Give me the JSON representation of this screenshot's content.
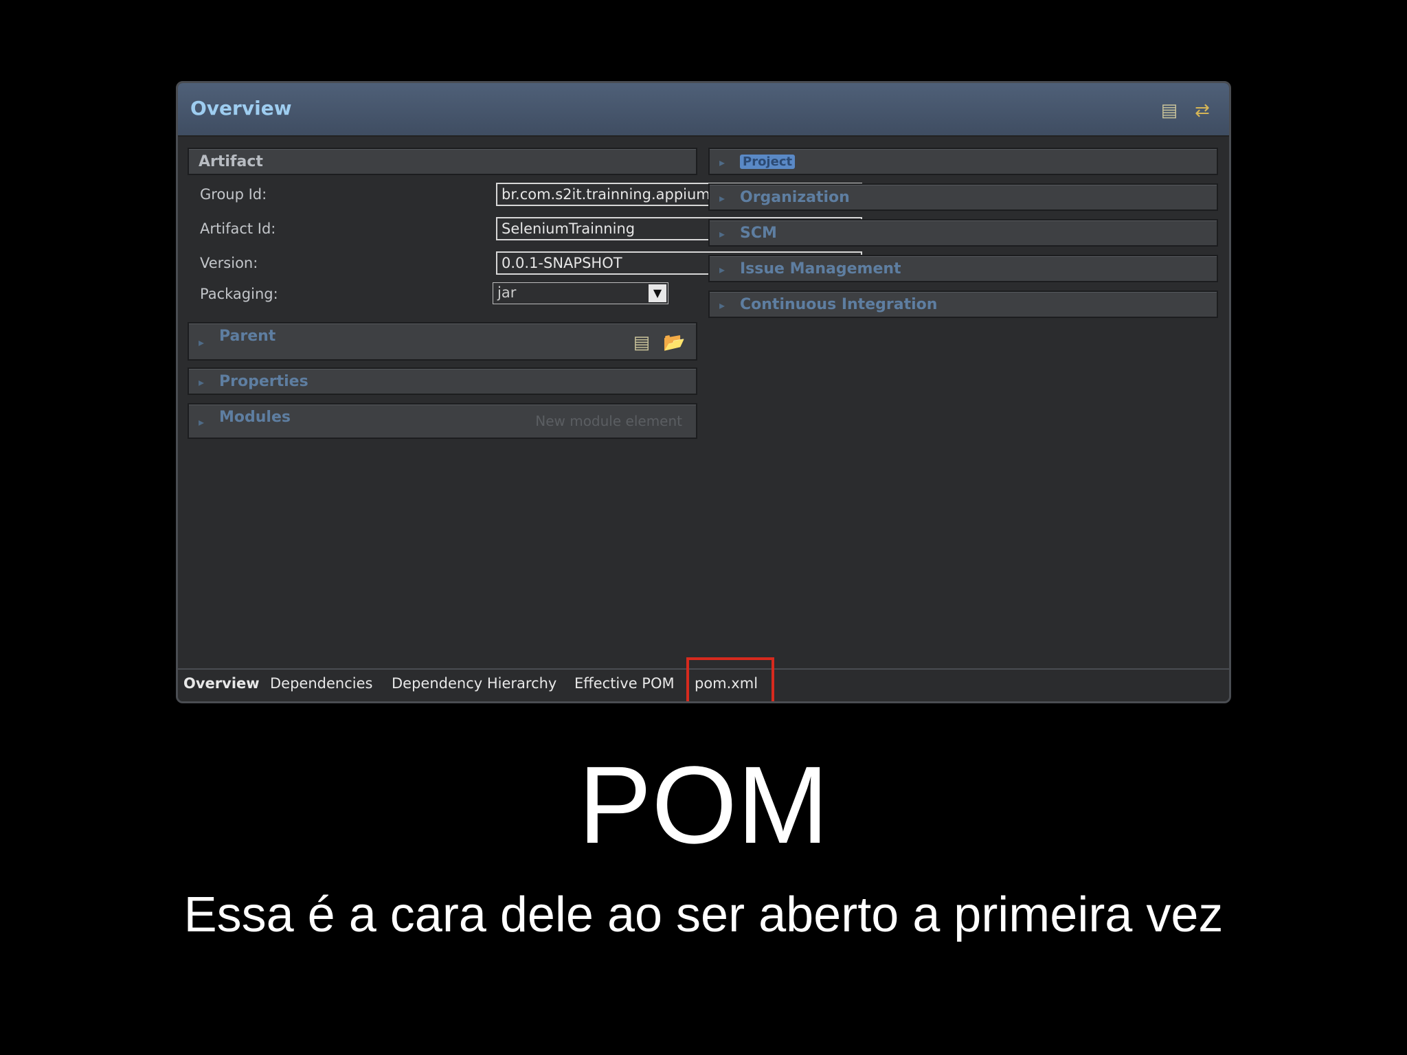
{
  "editor": {
    "title": "Overview",
    "artifact": {
      "section_title": "Artifact",
      "group_id_label": "Group Id:",
      "group_id_value": "br.com.s2it.trainning.appium",
      "artifact_id_label": "Artifact Id:",
      "artifact_id_value": "SeleniumTrainning",
      "version_label": "Version:",
      "version_value": "0.0.1-SNAPSHOT",
      "packaging_label": "Packaging:",
      "packaging_value": "jar"
    },
    "left_sections": {
      "parent": "Parent",
      "properties": "Properties",
      "modules": "Modules",
      "modules_hint": "New module element"
    },
    "right_sections": [
      "Project",
      "Organization",
      "SCM",
      "Issue Management",
      "Continuous Integration"
    ],
    "tabs": [
      "Overview",
      "Dependencies",
      "Dependency Hierarchy",
      "Effective POM",
      "pom.xml"
    ]
  },
  "slide": {
    "title": "POM",
    "subtitle": "Essa é a cara dele ao ser aberto a primeira vez"
  },
  "colors": {
    "highlight": "#d62a1e",
    "header": "#4f6078"
  }
}
